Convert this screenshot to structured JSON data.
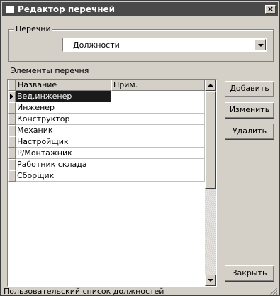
{
  "window": {
    "title": "Редактор перечней"
  },
  "group": {
    "legend": "Перечни",
    "selected": "Должности"
  },
  "elements_label": "Элементы перечня",
  "grid": {
    "columns": [
      "Название",
      "Прим."
    ],
    "rows": [
      {
        "name": "Вед.инженер",
        "note": ""
      },
      {
        "name": "Инженер",
        "note": ""
      },
      {
        "name": "Конструктор",
        "note": ""
      },
      {
        "name": "Механик",
        "note": ""
      },
      {
        "name": "Настройщик",
        "note": ""
      },
      {
        "name": "Р/Монтажник",
        "note": ""
      },
      {
        "name": "Работник склада",
        "note": ""
      },
      {
        "name": "Сборщик",
        "note": ""
      }
    ],
    "selected_row": 0
  },
  "buttons": {
    "add": "Добавить",
    "edit": "Изменить",
    "delete": "Удалить",
    "close": "Закрыть"
  },
  "status": "Пользовательский список должностей",
  "icons": {
    "window": "list-window-icon",
    "close": "close-icon",
    "dropdown": "chevron-down-icon",
    "row_pointer": "row-pointer-icon",
    "scroll_up": "arrow-up-icon",
    "scroll_down": "arrow-down-icon",
    "grip": "resize-grip-icon"
  },
  "colors": {
    "titlebar": "#4a4a4a",
    "face": "#d4d0c8",
    "selection": "#1a1a1a"
  }
}
